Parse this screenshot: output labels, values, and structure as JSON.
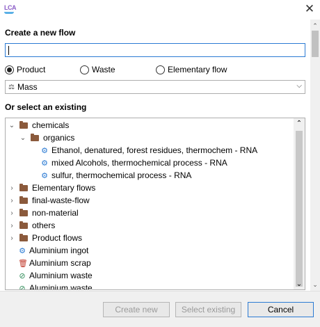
{
  "window": {
    "app_icon_text": "LCA",
    "close_glyph": "✕"
  },
  "create": {
    "heading": "Create a new flow",
    "name_value": "",
    "flow_types": [
      {
        "label": "Product",
        "selected": true
      },
      {
        "label": "Waste",
        "selected": false
      },
      {
        "label": "Elementary flow",
        "selected": false
      }
    ],
    "property": {
      "icon": "balance-scale-icon",
      "value": "Mass"
    }
  },
  "existing": {
    "heading": "Or select an existing",
    "tree": [
      {
        "label": "chemicals",
        "type": "folder",
        "expanded": true
      },
      {
        "label": "organics",
        "type": "folder",
        "expanded": true
      },
      {
        "label": "Ethanol, denatured, forest residues, thermochem - RNA",
        "type": "product"
      },
      {
        "label": "mixed Alcohols, thermochemical process - RNA",
        "type": "product"
      },
      {
        "label": "sulfur, thermochemical process - RNA",
        "type": "product"
      },
      {
        "label": "Elementary flows",
        "type": "folder",
        "expanded": false
      },
      {
        "label": "final-waste-flow",
        "type": "folder",
        "expanded": false
      },
      {
        "label": "non-material",
        "type": "folder",
        "expanded": false
      },
      {
        "label": "others",
        "type": "folder",
        "expanded": false
      },
      {
        "label": "Product flows",
        "type": "folder",
        "expanded": false
      },
      {
        "label": "Aluminium ingot",
        "type": "product"
      },
      {
        "label": "Aluminium scrap",
        "type": "waste"
      },
      {
        "label": "Aluminium waste",
        "type": "elementary"
      },
      {
        "label": "Aluminium waste",
        "type": "elementary"
      }
    ]
  },
  "buttons": {
    "create": "Create new",
    "select": "Select existing",
    "cancel": "Cancel"
  },
  "colors": {
    "accent": "#2a7ad3",
    "folder": "#8b5a3c",
    "product_icon": "#2a7ad3",
    "waste_icon": "#c0392b",
    "elementary_icon": "#2e8b57"
  }
}
